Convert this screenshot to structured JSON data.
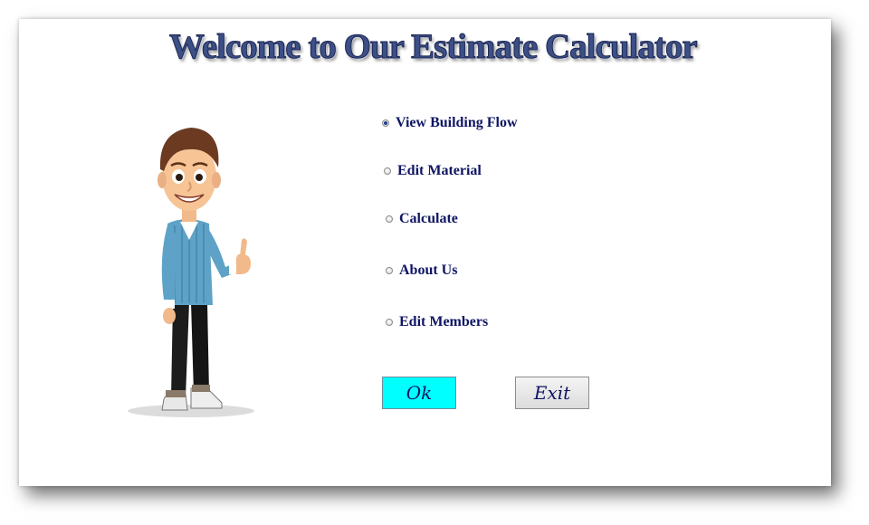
{
  "title": "Welcome to Our Estimate Calculator",
  "menu": {
    "options": [
      {
        "label": "View Building Flow",
        "selected": true
      },
      {
        "label": "Edit Material",
        "selected": false
      },
      {
        "label": "Calculate",
        "selected": false
      },
      {
        "label": "About Us",
        "selected": false
      },
      {
        "label": "Edit Members",
        "selected": false
      }
    ]
  },
  "buttons": {
    "ok_label": "Ok",
    "exit_label": "Exit"
  },
  "colors": {
    "ok_background": "#00ffff",
    "label_text": "#0f1563",
    "title_text": "#3c4f86"
  },
  "image": {
    "character_icon": "cartoon-man-thumbs-up"
  }
}
